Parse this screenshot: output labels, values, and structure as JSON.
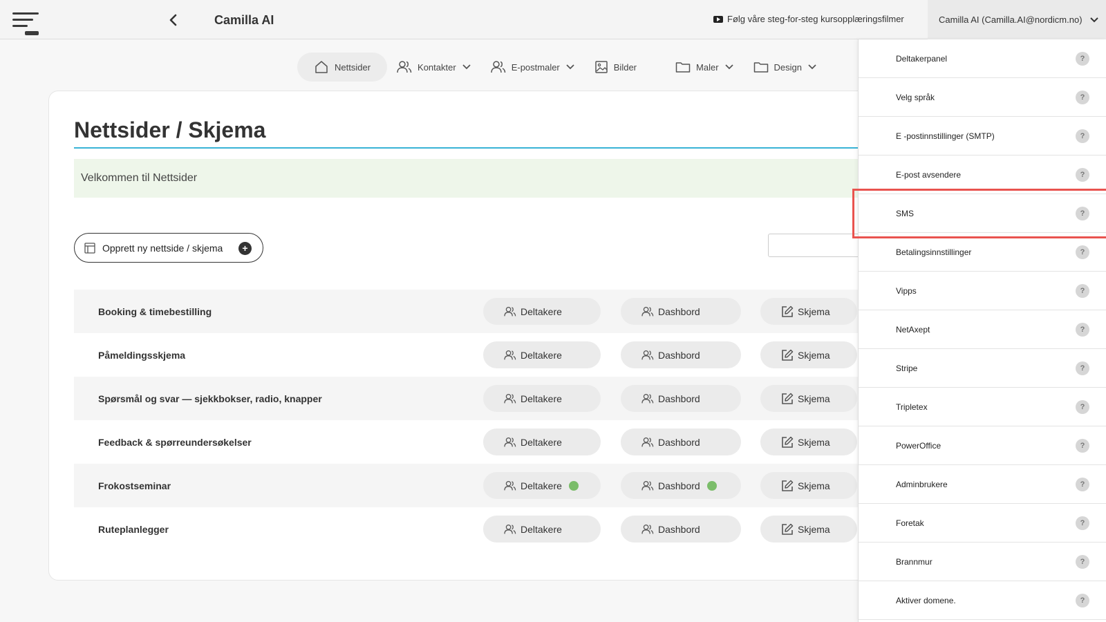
{
  "header": {
    "app_title": "Camilla AI",
    "tutorial_link": "Følg våre steg-for-steg kursopplæringsfilmer",
    "user_label": "Camilla AI (Camilla.AI@nordicm.no)"
  },
  "nav": {
    "items": [
      {
        "label": "Nettsider",
        "icon": "home-icon",
        "dropdown": false
      },
      {
        "label": "Kontakter",
        "icon": "users-icon",
        "dropdown": true
      },
      {
        "label": "E-postmaler",
        "icon": "users-icon",
        "dropdown": true
      },
      {
        "label": "Bilder",
        "icon": "image-icon",
        "dropdown": false
      },
      {
        "label": "Maler",
        "icon": "folder-icon",
        "dropdown": true
      },
      {
        "label": "Design",
        "icon": "folder-icon",
        "dropdown": true
      }
    ]
  },
  "main": {
    "title": "Nettsider / Skjema",
    "welcome": "Velkommen til Nettsider",
    "create_label": "Opprett ny nettside / skjema",
    "plus_glyph": "+",
    "rows": [
      {
        "title": "Booking & timebestilling",
        "participants": "Deltakere",
        "dashboard": "Dashbord",
        "form": "Skjema",
        "active": false
      },
      {
        "title": "Påmeldingsskjema",
        "participants": "Deltakere",
        "dashboard": "Dashbord",
        "form": "Skjema",
        "active": false
      },
      {
        "title": "Spørsmål og svar — sjekkbokser, radio, knapper",
        "participants": "Deltakere",
        "dashboard": "Dashbord",
        "form": "Skjema",
        "active": false
      },
      {
        "title": "Feedback & spørreundersøkelser",
        "participants": "Deltakere",
        "dashboard": "Dashbord",
        "form": "Skjema",
        "active": false
      },
      {
        "title": "Frokostseminar",
        "participants": "Deltakere",
        "dashboard": "Dashbord",
        "form": "Skjema",
        "active": true
      },
      {
        "title": "Ruteplanlegger",
        "participants": "Deltakere",
        "dashboard": "Dashbord",
        "form": "Skjema",
        "active": false
      }
    ]
  },
  "settings_menu": {
    "help_glyph": "?",
    "items": [
      "Deltakerpanel",
      "Velg språk",
      "E -postinnstillinger (SMTP)",
      "E-post avsendere",
      "SMS",
      "Betalingsinnstillinger",
      "Vipps",
      "NetAxept",
      "Stripe",
      "Tripletex",
      "PowerOffice",
      "Adminbrukere",
      "Foretak",
      "Brannmur",
      "Aktiver domene."
    ],
    "highlighted": "SMS"
  },
  "colors": {
    "accent_rule": "#38b3d6",
    "welcome_bg": "#eef6ea",
    "status_dot": "#7bbd6a",
    "highlight_border": "#e9534f"
  }
}
